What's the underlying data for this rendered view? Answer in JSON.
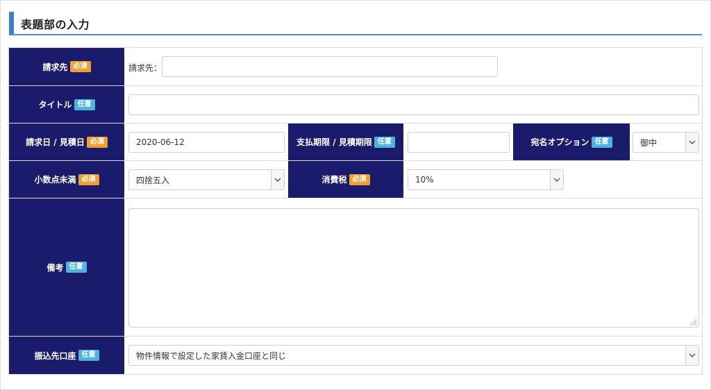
{
  "section": {
    "title": "表題部の入力"
  },
  "badges": {
    "required": "必須",
    "optional": "任意"
  },
  "rows": {
    "billing_to": {
      "label": "請求先",
      "inline_label": "請求先：",
      "value": ""
    },
    "title": {
      "label": "タイトル",
      "value": ""
    },
    "dates": {
      "date_label": "請求日 / 見積日",
      "date_value": "2020-06-12",
      "deadline_label": "支払期限 / 見積期限",
      "deadline_value": "",
      "honorific_label": "宛名オプション",
      "honorific_value": "御中"
    },
    "rounding": {
      "label": "小数点未満",
      "value": "四捨五入",
      "tax_label": "消費税",
      "tax_value": "10%"
    },
    "notes": {
      "label": "備考",
      "value": ""
    },
    "bank": {
      "label": "振込先口座",
      "value": "物件情報で設定した家賃入金口座と同じ"
    }
  },
  "colors": {
    "label_bg": "#1b1b6b",
    "badge_required": "#f0a032",
    "badge_optional": "#4fb3e0",
    "title_accent": "#3e7fc1"
  }
}
